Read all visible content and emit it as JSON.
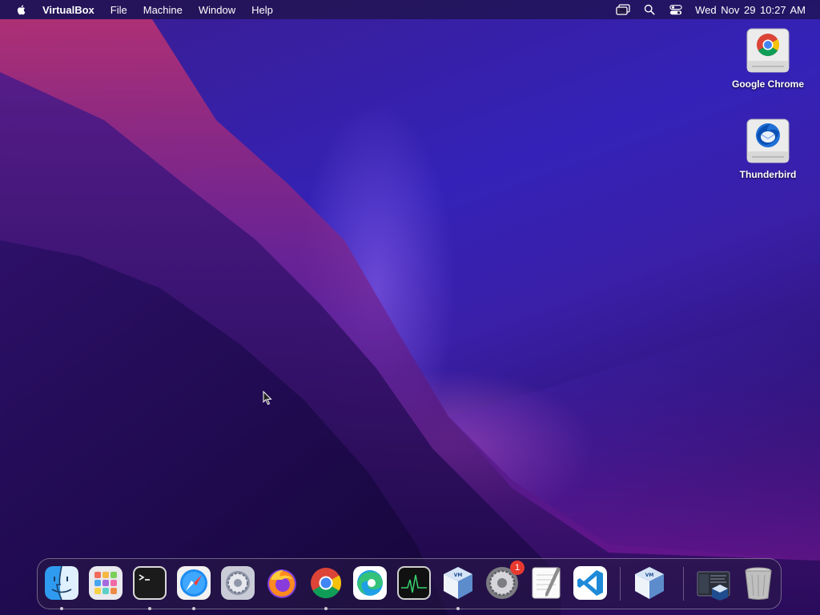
{
  "menubar": {
    "app_name": "VirtualBox",
    "items": [
      "File",
      "Machine",
      "Window",
      "Help"
    ],
    "clock": "Wed Nov 29  10:27 AM",
    "status_icons": [
      "screen-mirroring-icon",
      "search-icon",
      "control-center-icon"
    ]
  },
  "desktop": {
    "icons": [
      {
        "label": "Google Chrome",
        "icon": "chrome-drive-icon"
      },
      {
        "label": "Thunderbird",
        "icon": "thunderbird-drive-icon"
      }
    ]
  },
  "dock": {
    "apps": [
      {
        "name": "Finder",
        "icon": "finder-icon",
        "running": true
      },
      {
        "name": "Launchpad",
        "icon": "launchpad-icon",
        "running": false
      },
      {
        "name": "Terminal",
        "icon": "terminal-icon",
        "running": true
      },
      {
        "name": "Safari",
        "icon": "safari-icon",
        "running": true
      },
      {
        "name": "System Preferences",
        "icon": "settings-gear-icon",
        "running": false
      },
      {
        "name": "Firefox",
        "icon": "firefox-icon",
        "running": false
      },
      {
        "name": "Google Chrome",
        "icon": "chrome-icon",
        "running": true
      },
      {
        "name": "Microsoft Edge",
        "icon": "edge-icon",
        "running": false
      },
      {
        "name": "Activity Monitor",
        "icon": "activity-monitor-icon",
        "running": false
      },
      {
        "name": "VirtualBox",
        "icon": "virtualbox-icon",
        "running": true
      },
      {
        "name": "System Settings",
        "icon": "system-settings-icon",
        "running": false,
        "badge": "1"
      },
      {
        "name": "TextEdit",
        "icon": "textedit-icon",
        "running": false
      },
      {
        "name": "Visual Studio Code",
        "icon": "vscode-icon",
        "running": false
      },
      {
        "name": "VirtualBox",
        "icon": "virtualbox-icon",
        "running": false
      },
      {
        "name": "Downloads",
        "icon": "downloads-stack-icon",
        "running": false
      },
      {
        "name": "Trash",
        "icon": "trash-icon",
        "running": false
      }
    ]
  },
  "colors": {
    "wallpaper_top": "#3422b8",
    "wallpaper_bottom": "#1e0a4f",
    "accent_pink": "#c84fd0",
    "badge": "#e8392f"
  }
}
